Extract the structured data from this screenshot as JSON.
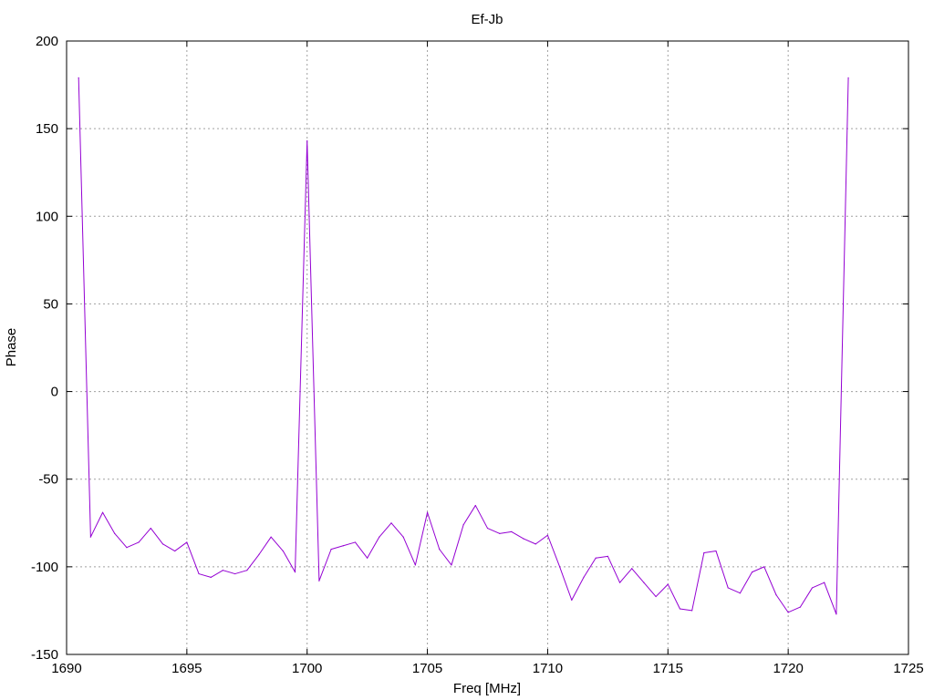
{
  "chart_data": {
    "type": "line",
    "title": "Ef-Jb",
    "xlabel": "Freq [MHz]",
    "ylabel": "Phase",
    "xlim": [
      1690,
      1725
    ],
    "ylim": [
      -150,
      200
    ],
    "xticks": [
      1690,
      1695,
      1700,
      1705,
      1710,
      1715,
      1720,
      1725
    ],
    "yticks": [
      -150,
      -100,
      -50,
      0,
      50,
      100,
      150,
      200
    ],
    "grid": true,
    "legend": "none",
    "series": [
      {
        "color": "#9400d3",
        "x": [
          1690.5,
          1691.0,
          1691.5,
          1692.0,
          1692.5,
          1693.0,
          1693.5,
          1694.0,
          1694.5,
          1695.0,
          1695.5,
          1696.0,
          1696.5,
          1697.0,
          1697.5,
          1698.0,
          1698.5,
          1699.0,
          1699.5,
          1700.0,
          1700.5,
          1701.0,
          1701.5,
          1702.0,
          1702.5,
          1703.0,
          1703.5,
          1704.0,
          1704.5,
          1705.0,
          1705.5,
          1706.0,
          1706.5,
          1707.0,
          1707.5,
          1708.0,
          1708.5,
          1709.0,
          1709.5,
          1710.0,
          1710.5,
          1711.0,
          1711.5,
          1712.0,
          1712.5,
          1713.0,
          1713.5,
          1714.0,
          1714.5,
          1715.0,
          1715.5,
          1716.0,
          1716.5,
          1717.0,
          1717.5,
          1718.0,
          1718.5,
          1719.0,
          1719.5,
          1720.0,
          1720.5,
          1721.0,
          1721.5,
          1722.0,
          1722.5
        ],
        "y": [
          179,
          -83,
          -69,
          -81,
          -89,
          -86,
          -78,
          -87,
          -91,
          -86,
          -104,
          -106,
          -102,
          -104,
          -102,
          -93,
          -83,
          -91,
          -103,
          143,
          -108,
          -90,
          -88,
          -86,
          -95,
          -83,
          -75,
          -83,
          -99,
          -69,
          -90,
          -99,
          -76,
          -65,
          -78,
          -81,
          -80,
          -84,
          -87,
          -82,
          -100,
          -119,
          -106,
          -95,
          -94,
          -109,
          -101,
          -109,
          -117,
          -110,
          -124,
          -125,
          -92,
          -91,
          -112,
          -115,
          -103,
          -100,
          -116,
          -126,
          -123,
          -112,
          -109,
          -127,
          179
        ]
      }
    ]
  }
}
